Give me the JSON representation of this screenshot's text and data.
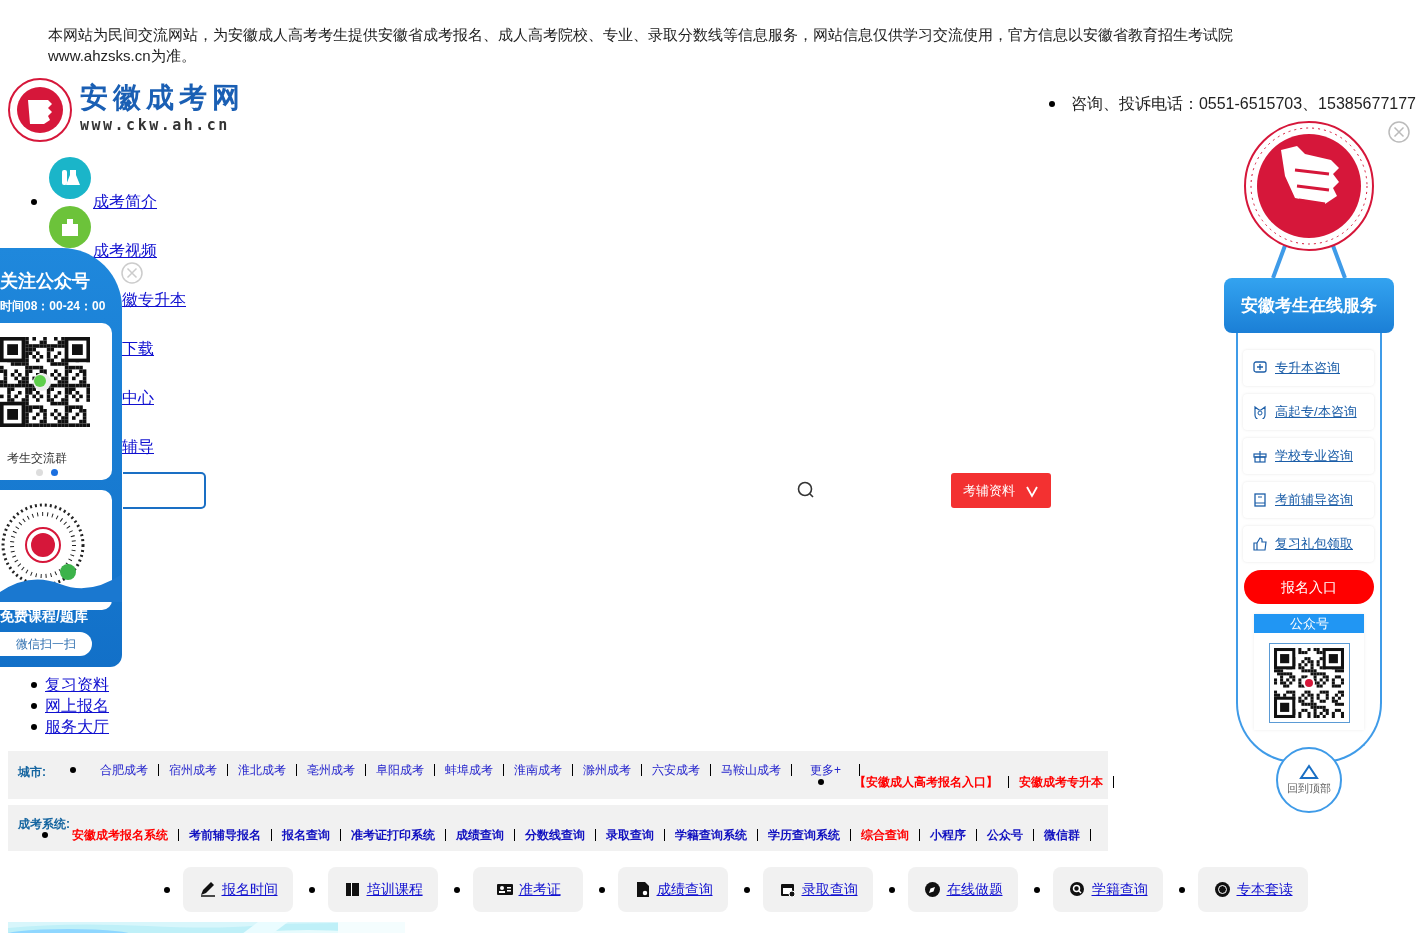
{
  "notice": "本网站为民间交流网站，为安徽成人高考考生提供安徽省成考报名、成人高考院校、专业、录取分数线等信息服务，网站信息仅供学习交流使用，官方信息以安徽省教育招生考试院www.ahzsks.cn为准。",
  "logo": {
    "title": "安徽成考网",
    "url": "www.ckw.ah.cn"
  },
  "contact": "咨询、投诉电话：0551-6515703、15385677177",
  "nav": [
    {
      "label": "成考简介",
      "kind": "lab"
    },
    {
      "label": "成考视频",
      "kind": "building"
    },
    {
      "label": "徽专升本",
      "kind": "covered"
    },
    {
      "label": "下载",
      "kind": "covered"
    },
    {
      "label": "中心",
      "kind": "covered"
    },
    {
      "label": "辅导",
      "kind": "covered"
    }
  ],
  "search": {
    "button": "考辅资料"
  },
  "links": [
    "复习资料",
    "网上报名",
    "服务大厅"
  ],
  "cities": {
    "label": "城市:",
    "items": [
      {
        "label": "合肥成考",
        "kind": "normal"
      },
      {
        "label": "宿州成考",
        "kind": "normal"
      },
      {
        "label": "淮北成考",
        "kind": "normal"
      },
      {
        "label": "亳州成考",
        "kind": "normal"
      },
      {
        "label": "阜阳成考",
        "kind": "normal"
      },
      {
        "label": "蚌埠成考",
        "kind": "normal"
      },
      {
        "label": "淮南成考",
        "kind": "normal"
      },
      {
        "label": "滁州成考",
        "kind": "normal"
      },
      {
        "label": "六安成考",
        "kind": "normal"
      },
      {
        "label": "马鞍山成考",
        "kind": "normal"
      },
      {
        "label": "更多+",
        "kind": "more"
      },
      {
        "label": "【安徽成人高考报名入口】",
        "kind": "highlight"
      },
      {
        "label": "安徽成考专升本",
        "kind": "highlight"
      }
    ]
  },
  "systems": {
    "label": "成考系统:",
    "items": [
      {
        "label": "安徽成考报名系统",
        "kind": "highlight"
      },
      {
        "label": "考前辅导报名",
        "kind": "normal"
      },
      {
        "label": "报名查询",
        "kind": "normal"
      },
      {
        "label": "准考证打印系统",
        "kind": "normal"
      },
      {
        "label": "成绩查询",
        "kind": "normal"
      },
      {
        "label": "分数线查询",
        "kind": "normal"
      },
      {
        "label": "录取查询",
        "kind": "normal"
      },
      {
        "label": "学籍查询系统",
        "kind": "normal"
      },
      {
        "label": "学历查询系统",
        "kind": "normal"
      },
      {
        "label": "综合查询",
        "kind": "highlight"
      },
      {
        "label": "小程序",
        "kind": "normal"
      },
      {
        "label": "公众号",
        "kind": "normal"
      },
      {
        "label": "微信群",
        "kind": "normal"
      }
    ]
  },
  "quick": [
    {
      "label": "报名时间",
      "kind": "pen"
    },
    {
      "label": "培训课程",
      "kind": "book"
    },
    {
      "label": "准考证",
      "kind": "card"
    },
    {
      "label": "成绩查询",
      "kind": "doc"
    },
    {
      "label": "录取查询",
      "kind": "calendar"
    },
    {
      "label": "在线做题",
      "kind": "compass"
    },
    {
      "label": "学籍查询",
      "kind": "search"
    },
    {
      "label": "专本套读",
      "kind": "badge"
    }
  ],
  "service": {
    "title": "安徽考生在线服务",
    "items": [
      {
        "label": "专升本咨询",
        "kind": "chat"
      },
      {
        "label": "高起专/本咨询",
        "kind": "owl"
      },
      {
        "label": "学校专业咨询",
        "kind": "gift"
      },
      {
        "label": "考前辅导咨询",
        "kind": "book"
      },
      {
        "label": "复习礼包领取",
        "kind": "thumb"
      }
    ],
    "signup": "报名入口",
    "wechat": "公众号",
    "back_top": "回到顶部"
  },
  "follow": {
    "title": "关注公众号",
    "hours": "时间08：00-24：00",
    "group": "考生交流群",
    "dots": [
      {
        "selected": false
      },
      {
        "selected": true
      }
    ],
    "subtitle": "免费课程/题库",
    "scan": "微信扫一扫"
  }
}
